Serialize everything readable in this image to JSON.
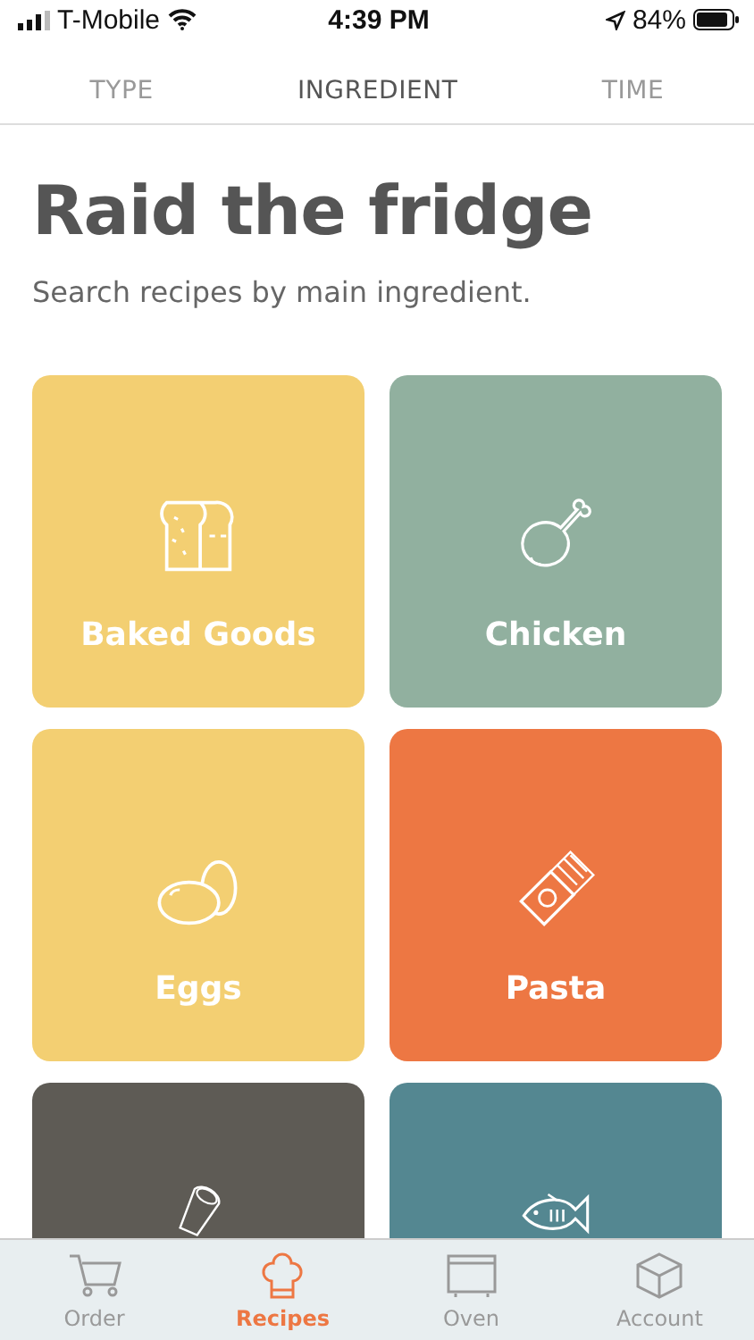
{
  "status_bar": {
    "carrier": "T-Mobile",
    "time": "4:39 PM",
    "battery": "84%"
  },
  "tabs": [
    {
      "label": "TYPE",
      "selected": false
    },
    {
      "label": "INGREDIENT",
      "selected": true
    },
    {
      "label": "TIME",
      "selected": false
    }
  ],
  "title": "Raid the fridge",
  "subtitle": "Search recipes by main ingredient.",
  "categories": [
    {
      "label": "Baked Goods",
      "kind": "bread",
      "color": "#f3cf72"
    },
    {
      "label": "Chicken",
      "kind": "drumstick",
      "color": "#91b09f"
    },
    {
      "label": "Eggs",
      "kind": "eggs",
      "color": "#f3cf72"
    },
    {
      "label": "Pasta",
      "kind": "pasta",
      "color": "#ed7743"
    },
    {
      "kind": "meat",
      "color": "#5e5b55"
    },
    {
      "kind": "fish",
      "color": "#548791"
    }
  ],
  "nav": [
    {
      "label": "Order",
      "kind": "cart",
      "selected": false
    },
    {
      "label": "Recipes",
      "kind": "chef",
      "selected": true
    },
    {
      "label": "Oven",
      "kind": "oven",
      "selected": false
    },
    {
      "label": "Account",
      "kind": "box",
      "selected": false
    }
  ]
}
